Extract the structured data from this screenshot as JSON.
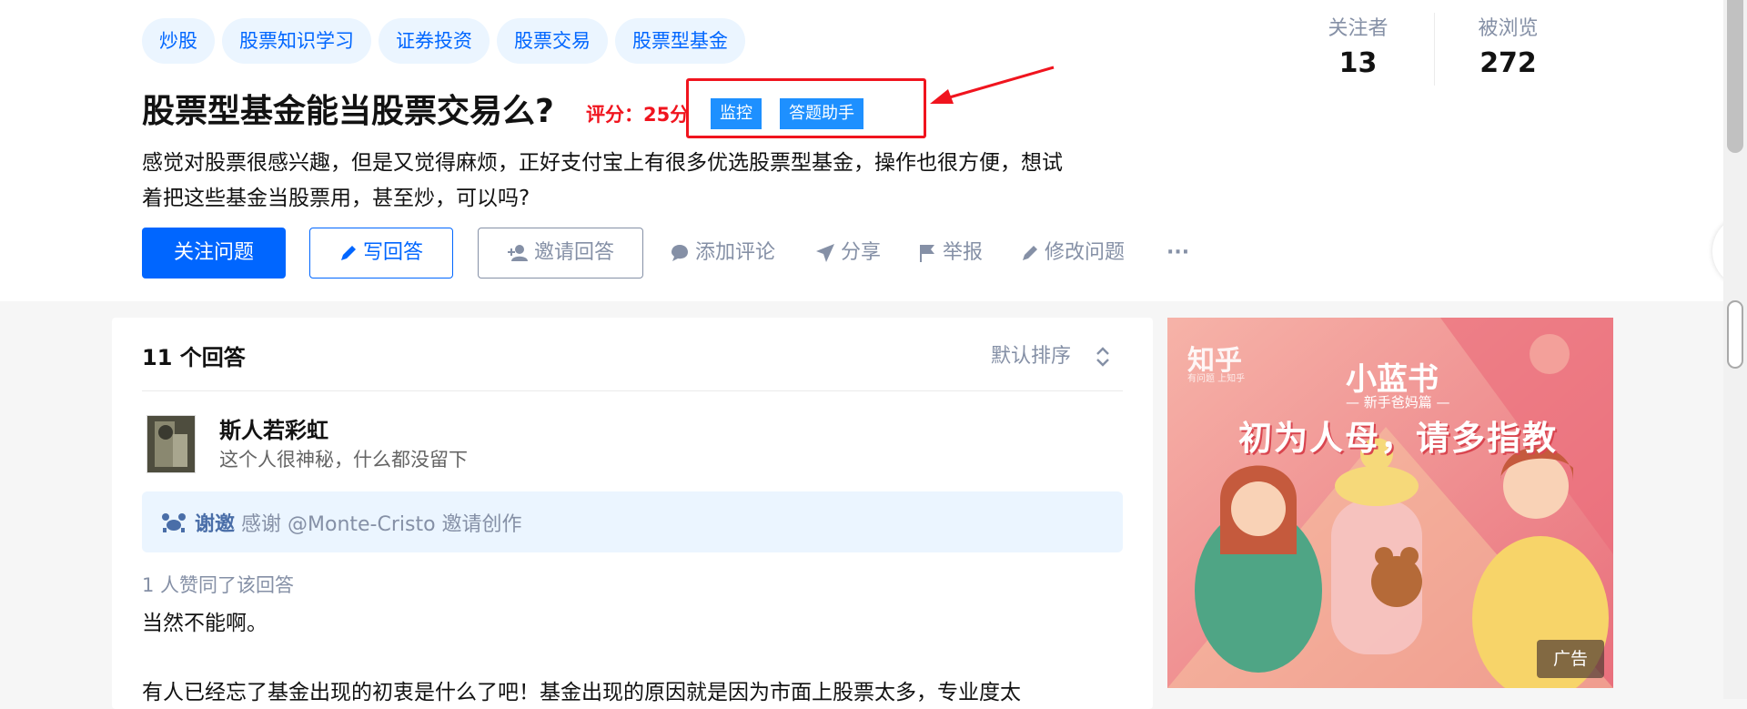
{
  "topics": [
    "炒股",
    "股票知识学习",
    "证券投资",
    "股票交易",
    "股票型基金"
  ],
  "question": {
    "title": "股票型基金能当股票交易么?",
    "score": "评分：25分",
    "plugin_buttons": [
      "监控",
      "答题助手"
    ],
    "description_line1": "感觉对股票很感兴趣，但是又觉得麻烦，正好支付宝上有很多优选股票型基金，操作也很方便，想试",
    "description_line2": "着把这些基金当股票用，甚至炒，可以吗?"
  },
  "actions": {
    "follow": "关注问题",
    "write": "写回答",
    "invite": "邀请回答",
    "comment": "添加评论",
    "share": "分享",
    "report": "举报",
    "edit": "修改问题",
    "more": "···"
  },
  "stats": {
    "followers_label": "关注者",
    "followers_value": "13",
    "views_label": "被浏览",
    "views_value": "272"
  },
  "answers": {
    "count_label": "11 个回答",
    "sort_label": "默认排序",
    "author_name": "斯人若彩虹",
    "author_bio": "这个人很神秘，什么都没留下",
    "invite_prefix": "谢邀",
    "invite_text": "感谢 @Monte-Cristo 邀请创作",
    "likes": "1 人赞同了该回答",
    "text_line1": "当然不能啊。",
    "text_line2": "有人已经忘了基金出现的初衷是什么了吧！基金出现的原因就是因为市面上股票太多，专业度太"
  },
  "ad": {
    "brand": "知乎",
    "brand_sub": "有问题 上知乎",
    "book": "小蓝书",
    "book_sub": "— 新手爸妈篇 —",
    "headline": "初为人母，请多指教",
    "ad_label": "广告"
  },
  "colors": {
    "accent": "#0066ff",
    "annotation_red": "#f0141e",
    "plugin_blue": "#1e90ff"
  }
}
